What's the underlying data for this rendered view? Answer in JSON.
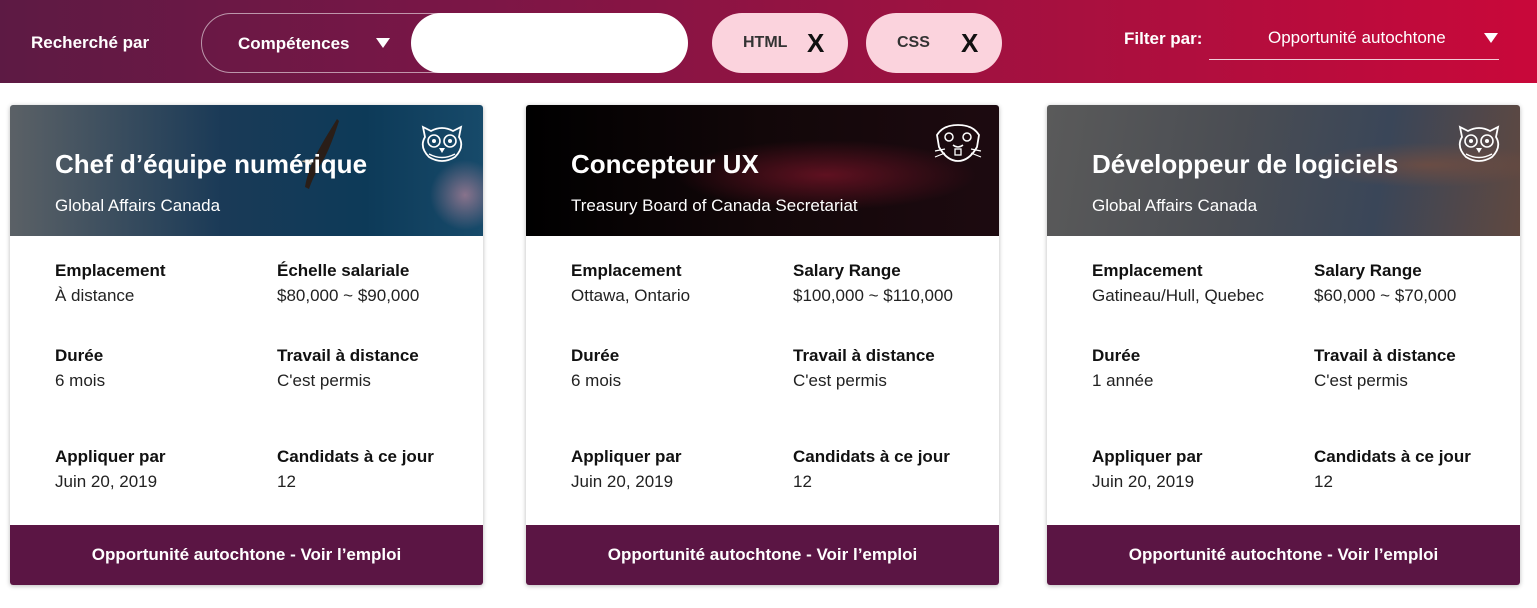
{
  "header": {
    "search_by_label": "Recherché par",
    "skill_select_value": "Compétences",
    "search_input_value": "",
    "search_input_placeholder": "",
    "chips": [
      {
        "label": "HTML",
        "remove": "X"
      },
      {
        "label": "CSS",
        "remove": "X"
      }
    ],
    "filter_label": "Filter par:",
    "filter_value": "Opportunité autochtone"
  },
  "colors": {
    "header_gradient_start": "#5d1a44",
    "header_gradient_end": "#c9083a",
    "chip_bg": "#fbd3dd",
    "button_bg": "#5b1544"
  },
  "cards": [
    {
      "title": "Chef d’équipe numérique",
      "org": "Global Affairs Canada",
      "emblem_icon": "owl-emblem-icon",
      "location_label": "Emplacement",
      "location_value": "À distance",
      "salary_label": "Échelle salariale",
      "salary_value": "$80,000 ~ $90,000",
      "duration_label": "Durée",
      "duration_value": "6 mois",
      "remote_label": "Travail à distance",
      "remote_value": "C'est permis",
      "apply_label": "Appliquer par",
      "apply_value": "Juin 20, 2019",
      "candidates_label": "Candidats à ce jour",
      "candidates_value": "12",
      "button_label": "Opportunité autochtone  - Voir l’emploi"
    },
    {
      "title": "Concepteur UX",
      "org": "Treasury Board of Canada Secretariat",
      "emblem_icon": "beaver-emblem-icon",
      "location_label": "Emplacement",
      "location_value": "Ottawa, Ontario",
      "salary_label": "Salary Range",
      "salary_value": "$100,000 ~ $110,000",
      "duration_label": "Durée",
      "duration_value": "6 mois",
      "remote_label": "Travail à distance",
      "remote_value": "C'est permis",
      "apply_label": "Appliquer par",
      "apply_value": "Juin 20, 2019",
      "candidates_label": "Candidats à ce jour",
      "candidates_value": "12",
      "button_label": "Opportunité autochtone  - Voir l’emploi"
    },
    {
      "title": "Développeur de logiciels",
      "org": "Global Affairs Canada",
      "emblem_icon": "owl-emblem-icon",
      "location_label": "Emplacement",
      "location_value": "Gatineau/Hull, Quebec",
      "salary_label": "Salary Range",
      "salary_value": "$60,000 ~ $70,000",
      "duration_label": "Durée",
      "duration_value": "1 année",
      "remote_label": "Travail à distance",
      "remote_value": "C'est permis",
      "apply_label": "Appliquer par",
      "apply_value": "Juin 20, 2019",
      "candidates_label": "Candidats à ce jour",
      "candidates_value": "12",
      "button_label": "Opportunité autochtone  - Voir l’emploi"
    }
  ]
}
